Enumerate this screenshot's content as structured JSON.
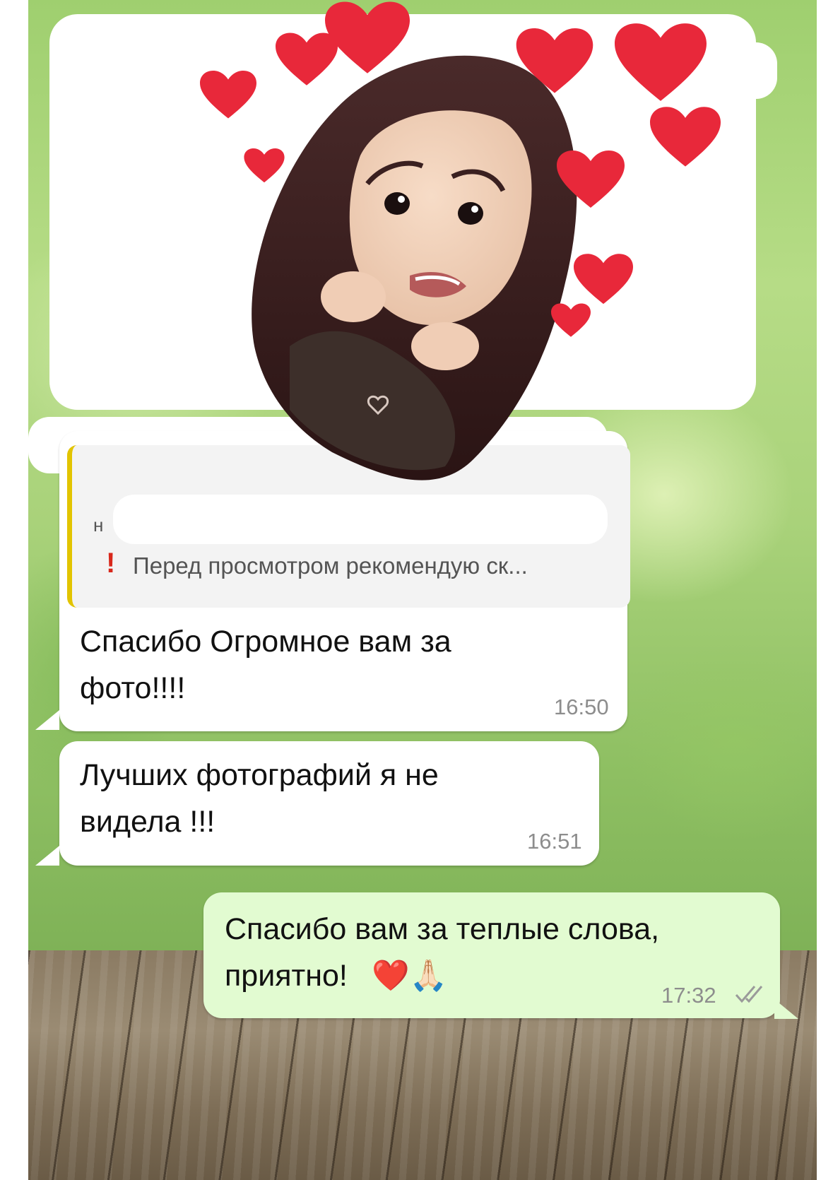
{
  "colors": {
    "incoming_bubble": "#ffffff",
    "outgoing_bubble": "#e2fbd1",
    "reply_accent": "#e2c400",
    "timestamp": "#8d8d8d",
    "heart": "#e8283a"
  },
  "sticker": {
    "icon": "avatar-sticker-with-hearts"
  },
  "reply_preview": {
    "partial_text": "н",
    "warning_icon": "exclamation-icon",
    "text": "Перед просмотром рекомендую ск..."
  },
  "messages": [
    {
      "direction": "incoming",
      "text": "Спасибо Огромное вам за\nфото!!!!",
      "time": "16:50"
    },
    {
      "direction": "incoming",
      "text": "Лучших фотографий я не\nвидела !!!",
      "time": "16:51"
    },
    {
      "direction": "outgoing",
      "text": "Спасибо вам за теплые слова,\nприятно!",
      "emoji": "❤️🙏🏻",
      "time": "17:32",
      "status_icon": "double-check-icon"
    }
  ]
}
